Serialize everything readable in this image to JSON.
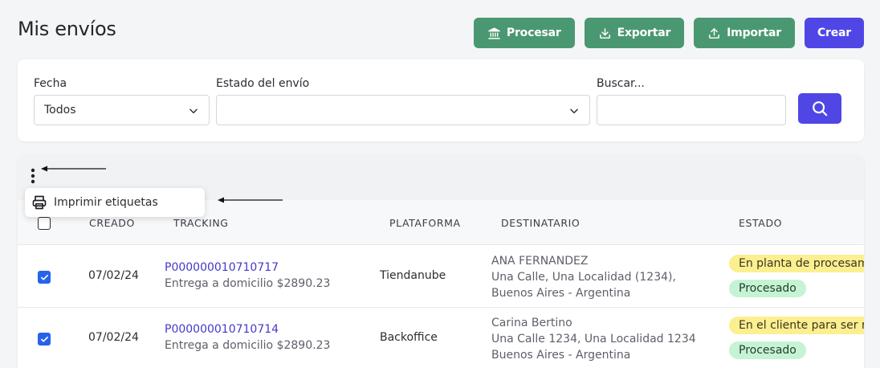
{
  "header": {
    "title": "Mis envíos",
    "buttons": {
      "procesar": "Procesar",
      "exportar": "Exportar",
      "importar": "Importar",
      "crear": "Crear"
    }
  },
  "filters": {
    "fecha_label": "Fecha",
    "fecha_value": "Todos",
    "estado_label": "Estado del envío",
    "estado_value": "",
    "buscar_label": "Buscar...",
    "buscar_value": ""
  },
  "menu": {
    "imprimir_label": "Imprimir etiquetas"
  },
  "table": {
    "columns": {
      "creado": "CREADO",
      "tracking": "TRACKING",
      "plataforma": "PLATAFORMA",
      "destinatario": "DESTINATARIO",
      "estado": "ESTADO"
    },
    "rows": [
      {
        "checked": true,
        "creado": "07/02/24",
        "tracking": "P000000010710717",
        "entrega": "Entrega a domicilio $2890.23",
        "plataforma": "Tiendanube",
        "dest_name": "ANA FERNANDEZ",
        "dest_addr1": "Una Calle, Una Localidad (1234),",
        "dest_addr2": "Buenos Aires - Argentina",
        "estado_1": "En planta de procesamiento",
        "estado_2": "Procesado"
      },
      {
        "checked": true,
        "creado": "07/02/24",
        "tracking": "P000000010710714",
        "entrega": "Entrega a domicilio $2890.23",
        "plataforma": "Backoffice",
        "dest_name": "Carina Bertino",
        "dest_addr1": "Una Calle 1234, Una Localidad 1234",
        "dest_addr2": "Buenos Aires - Argentina",
        "estado_1": "En el cliente para ser retirado",
        "estado_2": "Procesado"
      }
    ]
  },
  "colors": {
    "green": "#4a9871",
    "blue": "#4f46e5",
    "checkbox": "#2563eb",
    "badge_yellow": "#fcef90",
    "badge_green": "#c6f3d4"
  }
}
